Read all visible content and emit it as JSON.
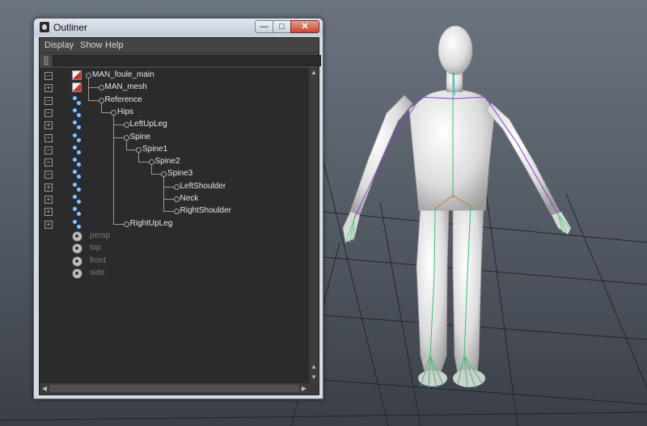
{
  "window": {
    "title": "Outliner",
    "minimize_glyph": "—",
    "maximize_glyph": "□",
    "close_glyph": "✕"
  },
  "menu": [
    "Display",
    "Show",
    "Help"
  ],
  "filter": {
    "value": ""
  },
  "tree": [
    {
      "label": "MAN_foule_main",
      "expander": "−",
      "icon": "transform-icon",
      "depth": 0,
      "dim": false
    },
    {
      "label": "MAN_mesh",
      "expander": "+",
      "icon": "transform-icon",
      "depth": 1,
      "dim": false
    },
    {
      "label": "Reference",
      "expander": "−",
      "icon": "joint-icon",
      "depth": 1,
      "dim": false
    },
    {
      "label": "Hips",
      "expander": "−",
      "icon": "joint-icon",
      "depth": 2,
      "dim": false
    },
    {
      "label": "LeftUpLeg",
      "expander": "+",
      "icon": "joint-icon",
      "depth": 3,
      "dim": false
    },
    {
      "label": "Spine",
      "expander": "−",
      "icon": "joint-icon",
      "depth": 3,
      "dim": false
    },
    {
      "label": "Spine1",
      "expander": "−",
      "icon": "joint-icon",
      "depth": 4,
      "dim": false
    },
    {
      "label": "Spine2",
      "expander": "−",
      "icon": "joint-icon",
      "depth": 5,
      "dim": false
    },
    {
      "label": "Spine3",
      "expander": "−",
      "icon": "joint-icon",
      "depth": 6,
      "dim": false
    },
    {
      "label": "LeftShoulder",
      "expander": "+",
      "icon": "joint-icon",
      "depth": 7,
      "dim": false
    },
    {
      "label": "Neck",
      "expander": "+",
      "icon": "joint-icon",
      "depth": 7,
      "dim": false
    },
    {
      "label": "RightShoulder",
      "expander": "+",
      "icon": "joint-icon",
      "depth": 7,
      "dim": false
    },
    {
      "label": "RightUpLeg",
      "expander": "+",
      "icon": "joint-icon",
      "depth": 3,
      "dim": false
    },
    {
      "label": "persp",
      "expander": "",
      "icon": "camera-icon",
      "depth": 0,
      "dim": true
    },
    {
      "label": "top",
      "expander": "",
      "icon": "camera-icon",
      "depth": 0,
      "dim": true
    },
    {
      "label": "front",
      "expander": "",
      "icon": "camera-icon",
      "depth": 0,
      "dim": true
    },
    {
      "label": "side",
      "expander": "",
      "icon": "camera-icon",
      "depth": 0,
      "dim": true
    }
  ],
  "colors": {
    "viewport_bg": "#5b636d",
    "model": "#e8e8e8",
    "skeleton_spine": "#3ac06a",
    "skeleton_arm_left": "#8a3fd6",
    "skeleton_arm_right": "#8a3fd6",
    "skeleton_hips": "#d07a2a",
    "skeleton_neck": "#3aa0d8"
  }
}
